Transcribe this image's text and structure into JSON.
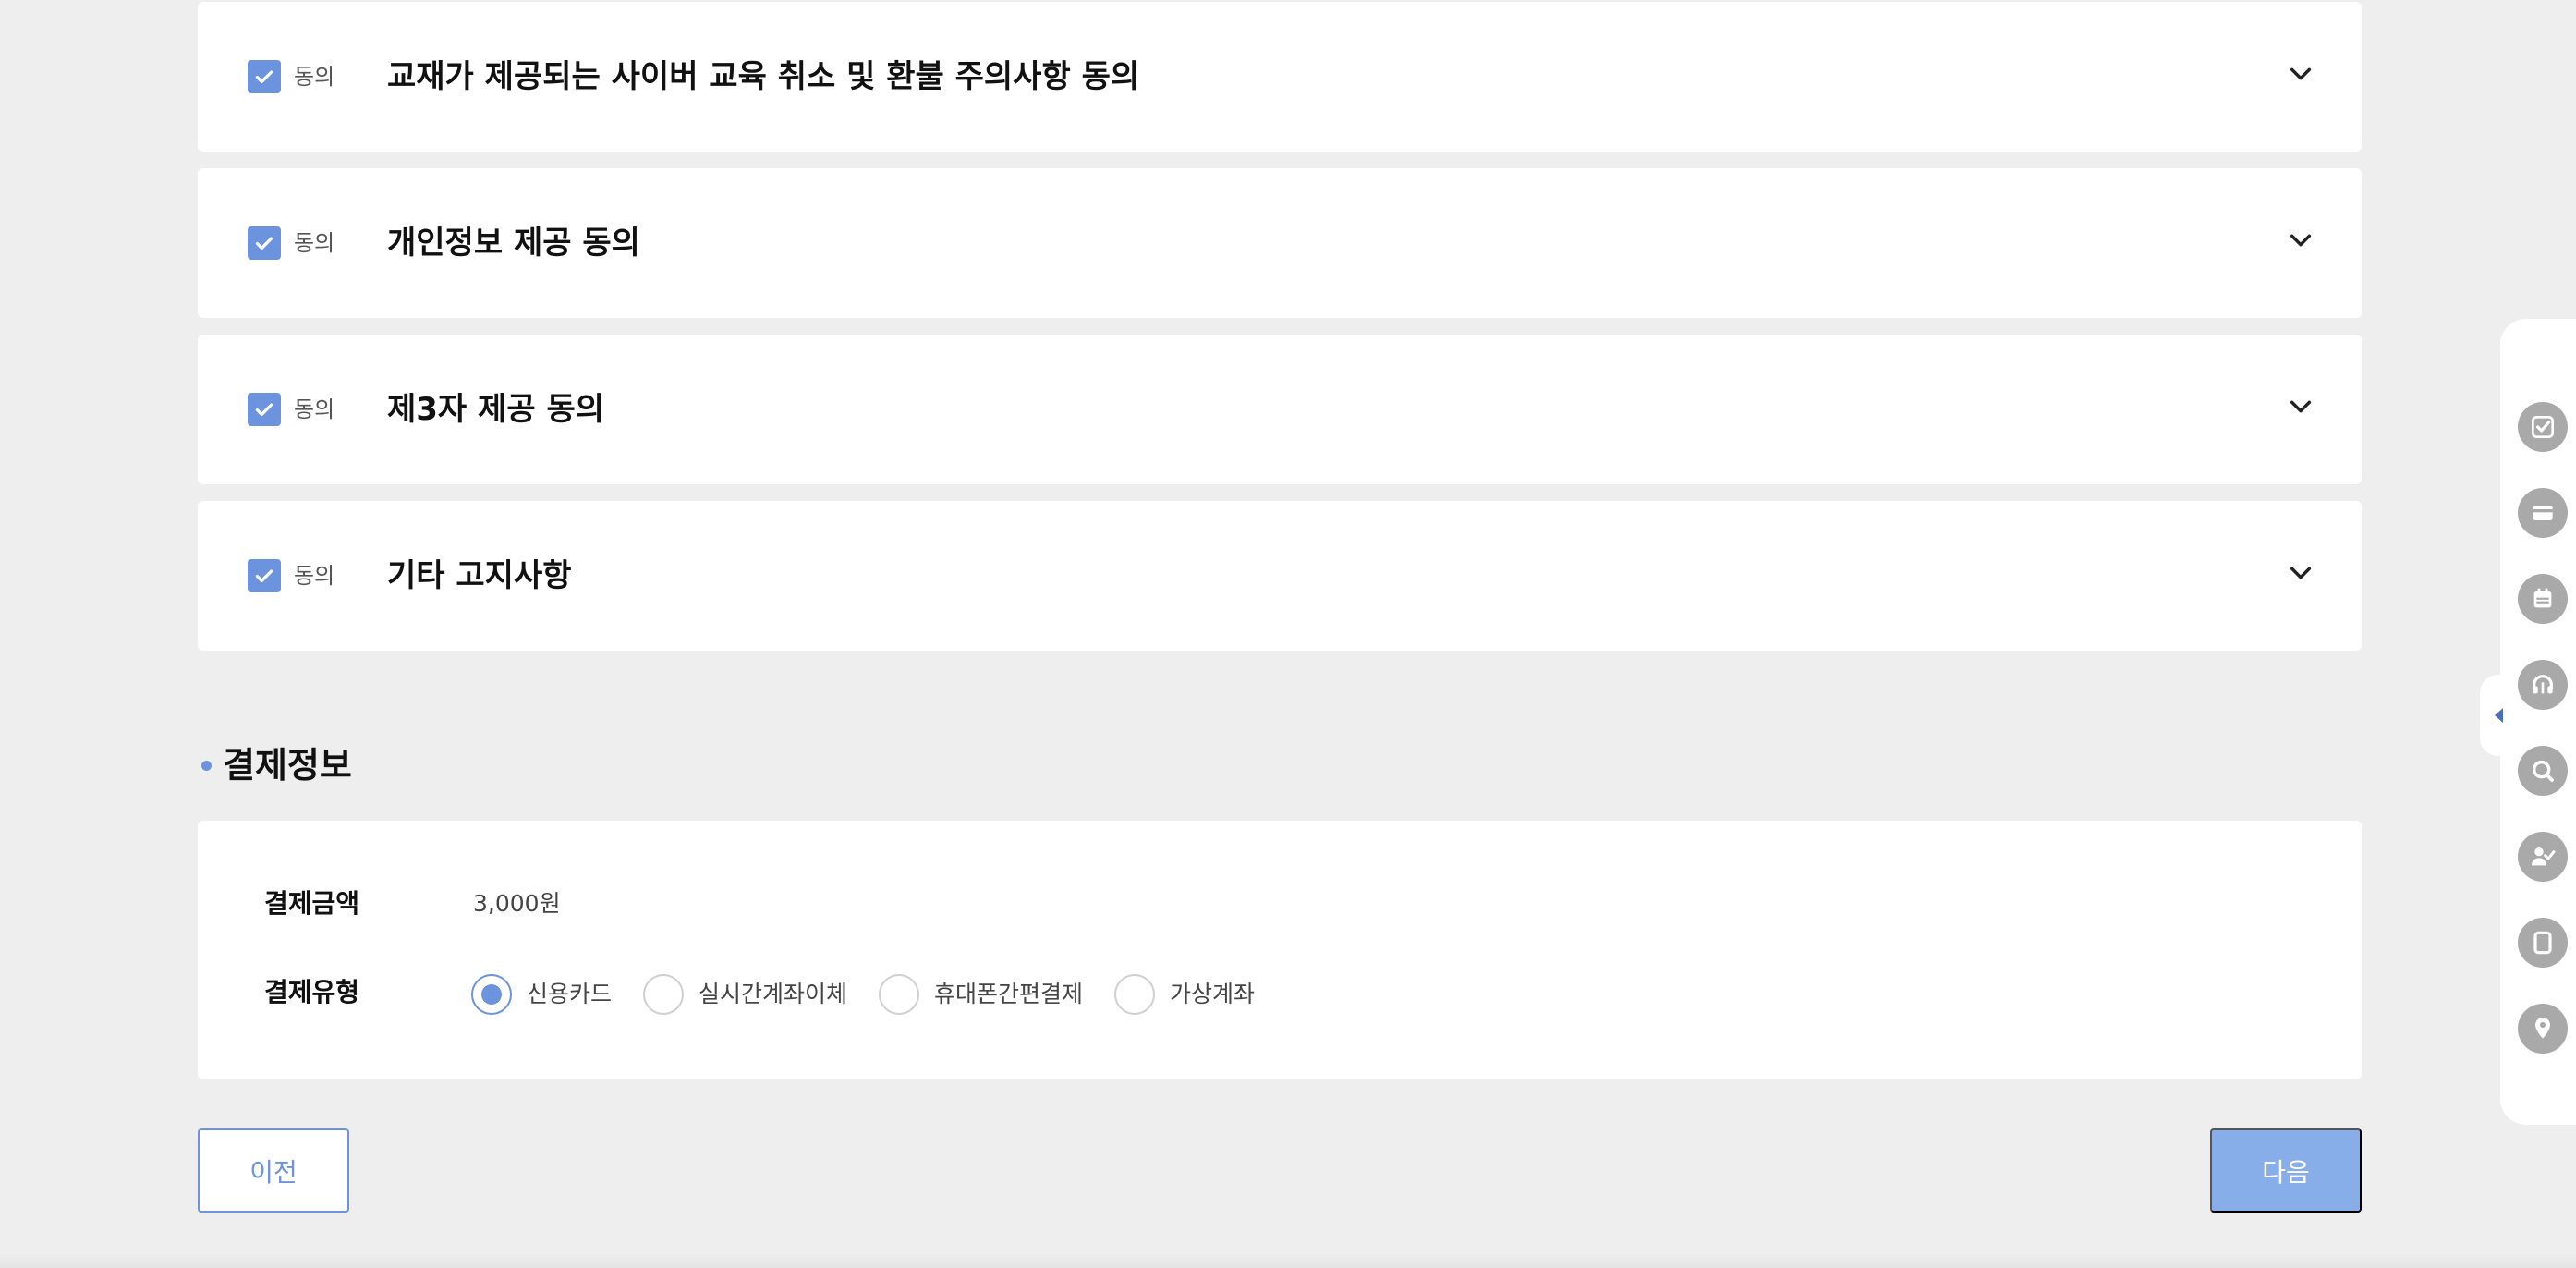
{
  "agreements": [
    {
      "checked_label": "동의",
      "title": "교재가 제공되는 사이버 교육 취소 및 환불 주의사항 동의",
      "checked": true
    },
    {
      "checked_label": "동의",
      "title": "개인정보 제공 동의",
      "checked": true
    },
    {
      "checked_label": "동의",
      "title": "제3자 제공 동의",
      "checked": true
    },
    {
      "checked_label": "동의",
      "title": "기타 고지사항",
      "checked": true
    }
  ],
  "payment": {
    "section_title": "결제정보",
    "amount_label": "결제금액",
    "amount_value": "3,000원",
    "type_label": "결제유형",
    "options": [
      "신용카드",
      "실시간계좌이체",
      "휴대폰간편결제",
      "가상계좌"
    ],
    "selected": "신용카드"
  },
  "buttons": {
    "prev": "이전",
    "next": "다음"
  },
  "quick_menu": {
    "icons": [
      "check-icon",
      "card-icon",
      "calendar-icon",
      "headset-icon",
      "search-icon",
      "user-check-icon",
      "tablet-icon",
      "location-pin-icon"
    ]
  },
  "colors": {
    "accent": "#6b93de",
    "next_button": "#88aeea",
    "background": "#eeeeee",
    "icon_gray": "#a9a9a9"
  }
}
